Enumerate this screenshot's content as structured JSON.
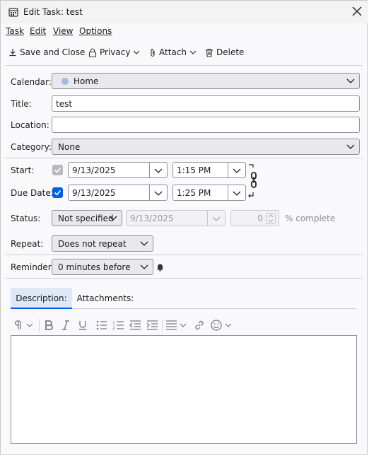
{
  "window": {
    "title": "Edit Task: test"
  },
  "menubar": {
    "task": "Task",
    "edit": "Edit",
    "view": "View",
    "options": "Options"
  },
  "toolbar": {
    "save_close": "Save and Close",
    "privacy": "Privacy",
    "attach": "Attach",
    "delete": "Delete"
  },
  "form": {
    "calendar_label": "Calendar:",
    "calendar_value": "Home",
    "calendar_color": "#a7b9e3",
    "title_label": "Title:",
    "title_value": "test",
    "location_label": "Location:",
    "location_value": "",
    "category_label": "Category:",
    "category_value": "None",
    "start_label": "Start:",
    "start_date": "9/13/2025",
    "start_time": "1:15 PM",
    "start_checked": true,
    "due_label": "Due Date:",
    "due_date": "9/13/2025",
    "due_time": "1:25 PM",
    "due_checked": true,
    "status_label": "Status:",
    "status_value": "Not specified",
    "status_date": "9/13/2025",
    "percent_value": "0",
    "percent_label": "% complete",
    "repeat_label": "Repeat:",
    "repeat_value": "Does not repeat",
    "reminder_label": "Reminder:",
    "reminder_value": "0 minutes before"
  },
  "tabs": {
    "description": "Description:",
    "attachments": "Attachments:"
  },
  "format_toolbar": {
    "icons": [
      "paragraph-icon",
      "bold-icon",
      "italic-icon",
      "underline-icon",
      "bullet-list-icon",
      "numbered-list-icon",
      "outdent-icon",
      "indent-icon",
      "align-icon",
      "link-icon",
      "emoji-icon"
    ]
  },
  "colors": {
    "accent": "#0060df",
    "tab_active_bg": "#dfe8f6"
  }
}
